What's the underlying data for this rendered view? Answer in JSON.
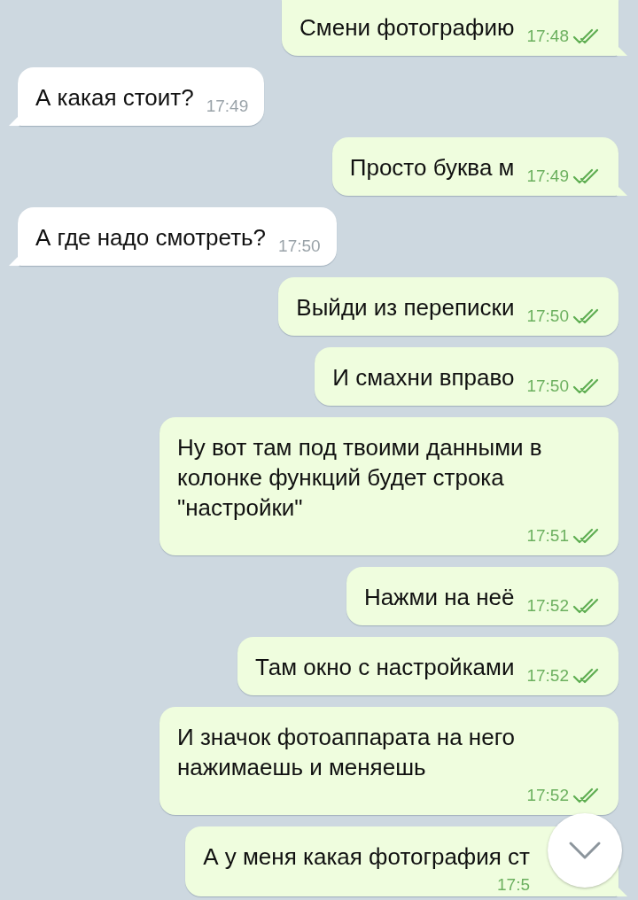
{
  "messages": [
    {
      "kind": "outgoing",
      "text": "Смени фотографию",
      "time": "17:48",
      "read": true
    },
    {
      "kind": "incoming",
      "text": "А какая стоит?",
      "time": "17:49",
      "read": false
    },
    {
      "kind": "outgoing",
      "text": "Просто буква м",
      "time": "17:49",
      "read": true
    },
    {
      "kind": "incoming",
      "text": "А где надо смотреть?",
      "time": "17:50",
      "read": false
    },
    {
      "kind": "outgoing",
      "text": "Выйди из переписки",
      "time": "17:50",
      "read": true
    },
    {
      "kind": "outgoing",
      "text": "И смахни вправо",
      "time": "17:50",
      "read": true
    },
    {
      "kind": "outgoing",
      "text": "Ну вот там под твоими данными в колонке функций будет строка \"настройки\"",
      "time": "17:51",
      "read": true
    },
    {
      "kind": "outgoing",
      "text": "Нажми на неё",
      "time": "17:52",
      "read": true
    },
    {
      "kind": "outgoing",
      "text": "Там окно с настройками",
      "time": "17:52",
      "read": true
    },
    {
      "kind": "outgoing",
      "text": "И значок фотоаппарата на него нажимаешь и меняешь",
      "time": "17:52",
      "read": true
    },
    {
      "kind": "outgoing",
      "text": "А у меня какая фотография ст",
      "time": "17:5",
      "read": false
    }
  ]
}
